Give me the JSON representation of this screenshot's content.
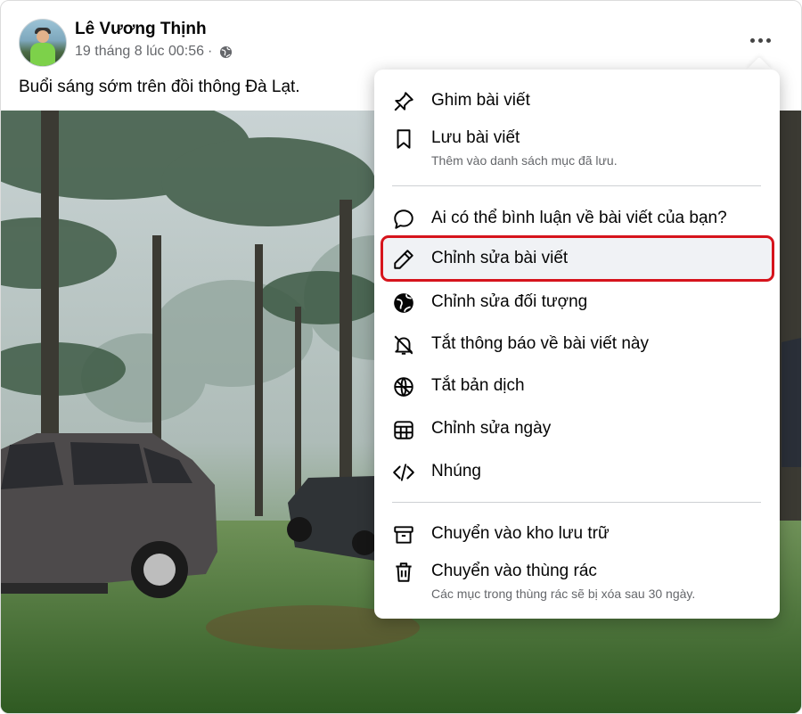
{
  "post": {
    "author": "Lê Vương Thịnh",
    "timestamp": "19 tháng 8 lúc 00:56",
    "separator": "·",
    "caption": "Buổi sáng sớm trên đồi thông Đà Lạt.",
    "privacy_icon": "globe-icon"
  },
  "menu": {
    "items": [
      {
        "label": "Ghim bài viết",
        "icon": "pin-icon"
      },
      {
        "label": "Lưu bài viết",
        "sub": "Thêm vào danh sách mục đã lưu.",
        "icon": "bookmark-icon"
      },
      {
        "label": "Ai có thể bình luận về bài viết của bạn?",
        "icon": "comment-icon"
      },
      {
        "label": "Chỉnh sửa bài viết",
        "icon": "pencil-icon",
        "highlighted": true
      },
      {
        "label": "Chỉnh sửa đối tượng",
        "icon": "globe-filled-icon"
      },
      {
        "label": "Tắt thông báo về bài viết này",
        "icon": "bell-off-icon"
      },
      {
        "label": "Tắt bản dịch",
        "icon": "translate-globe-icon"
      },
      {
        "label": "Chỉnh sửa ngày",
        "icon": "calendar-icon"
      },
      {
        "label": "Nhúng",
        "icon": "code-icon"
      },
      {
        "label": "Chuyển vào kho lưu trữ",
        "icon": "archive-icon"
      },
      {
        "label": "Chuyển vào thùng rác",
        "sub": "Các mục trong thùng rác sẽ bị xóa sau 30 ngày.",
        "icon": "trash-icon"
      }
    ]
  },
  "colors": {
    "highlight_border": "#d6141c",
    "text_secondary": "#65676b"
  }
}
